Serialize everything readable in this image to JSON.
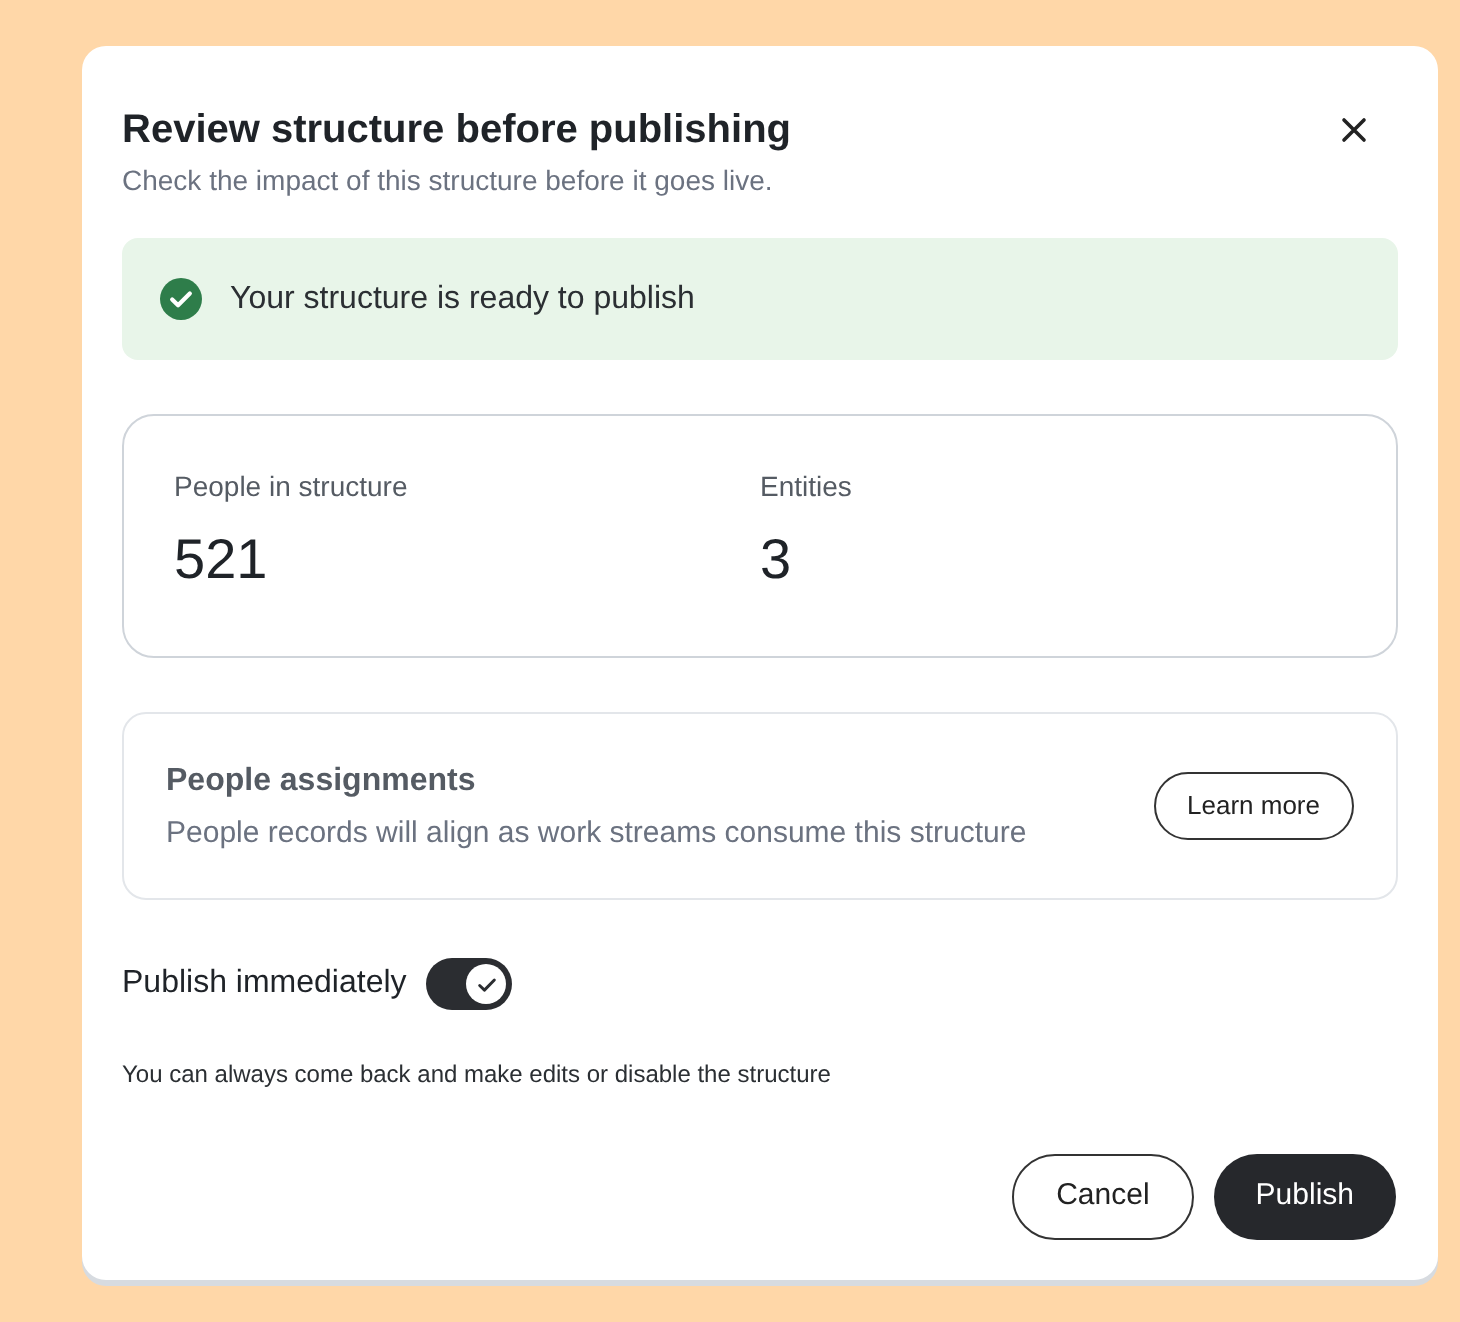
{
  "dialog": {
    "title": "Review structure before publishing",
    "subtitle": "Check the impact of this structure before it goes live."
  },
  "alert": {
    "kind": "success",
    "text": "Your structure is ready to publish"
  },
  "stats": [
    {
      "label": "People in structure",
      "value": "521"
    },
    {
      "label": "Entities",
      "value": "3"
    }
  ],
  "info_card": {
    "title": "People assignments",
    "text": "People records will align as work streams consume this structure",
    "button": "Learn more"
  },
  "publish_toggle": {
    "label": "Publish immediately",
    "on": true
  },
  "note": "You can always come back and make edits or disable the structure",
  "buttons": [
    {
      "label": "Cancel",
      "kind": "secondary"
    },
    {
      "label": "Publish",
      "kind": "primary"
    }
  ]
}
